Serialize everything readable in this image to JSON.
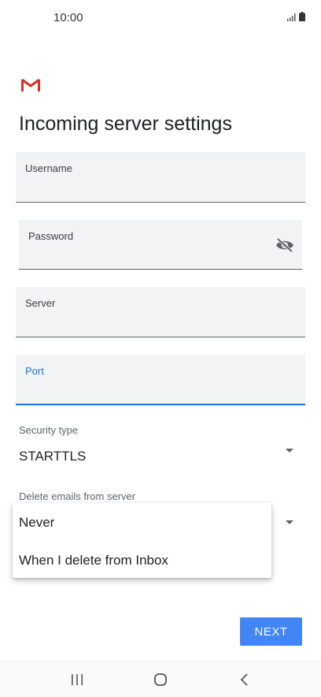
{
  "status_bar": {
    "time": "10:00",
    "icons": [
      "signal-icon",
      "battery-icon"
    ]
  },
  "app": {
    "logo": "gmail-logo-icon"
  },
  "page": {
    "title": "Incoming server settings"
  },
  "fields": {
    "username": {
      "label": "Username",
      "value": ""
    },
    "password": {
      "label": "Password",
      "value": ""
    },
    "server": {
      "label": "Server",
      "value": ""
    },
    "port": {
      "label": "Port",
      "value": ""
    }
  },
  "security_type": {
    "label": "Security type",
    "value": "STARTTLS"
  },
  "delete_emails": {
    "label": "Delete emails from server",
    "options": [
      "Never",
      "When I delete from Inbox"
    ]
  },
  "actions": {
    "next_label": "NEXT"
  },
  "colors": {
    "accent": "#4285f4",
    "focus": "#1a73e8",
    "gmail_red": "#d93025"
  },
  "nav_bar": {
    "buttons": [
      "recent-apps-icon",
      "home-icon",
      "back-icon"
    ]
  }
}
